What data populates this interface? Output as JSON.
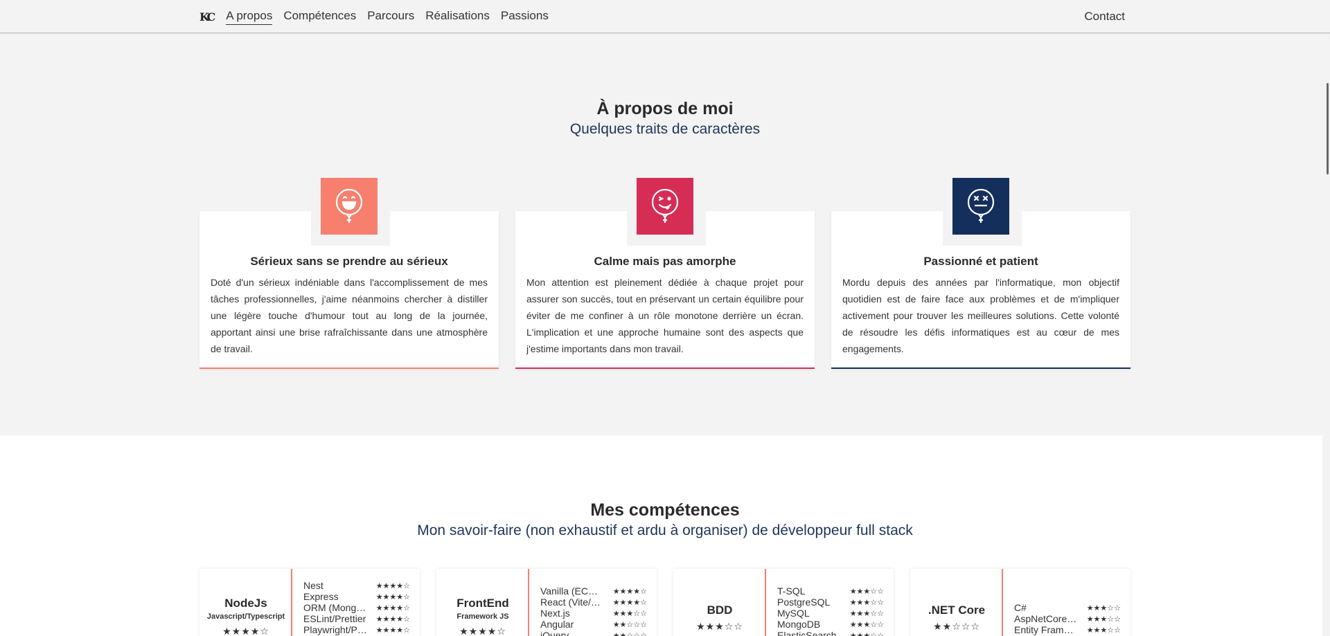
{
  "nav": {
    "logo": "KC",
    "links": [
      "A propos",
      "Compétences",
      "Parcours",
      "Réalisations",
      "Passions"
    ],
    "contact": "Contact"
  },
  "about": {
    "title": "À propos de moi",
    "subtitle": "Quelques traits de caractères",
    "traits": [
      {
        "title": "Sérieux sans se prendre au sérieux",
        "text": "Doté d'un sérieux indéniable dans l'accomplissement de mes tâches professionnelles, j'aime néanmoins chercher à distiller une légère touche d'humour tout au long de la journée, apportant ainsi une brise rafraîchissante dans une atmosphère de travail.",
        "color": "#f77f6e",
        "icon": "laughing-balloon-icon"
      },
      {
        "title": "Calme mais pas amorphe",
        "text": "Mon attention est pleinement dédiée à chaque projet pour assurer son succès, tout en préservant un certain équilibre pour éviter de me confiner à un rôle monotone derrière un écran. L'implication et une approche humaine sont des aspects que j'estime importants dans mon travail.",
        "color": "#d62d55",
        "icon": "winking-balloon-icon"
      },
      {
        "title": "Passionné et patient",
        "text": "Mordu depuis des années par l'informatique, mon objectif quotidien est de faire face aux problèmes et de m'impliquer activement pour trouver les meilleures solutions. Cette volonté de résoudre les défis informatiques est au cœur de mes engagements.",
        "color": "#142f5c",
        "icon": "dizzy-balloon-icon"
      }
    ]
  },
  "skills": {
    "title": "Mes compétences",
    "subtitle": "Mon savoir-faire (non exhaustif et ardu à organiser) de développeur full stack",
    "cards": [
      {
        "name": "NodeJs",
        "sub": "Javascript/Typescript",
        "stars": "★★★★☆",
        "items": [
          {
            "name": "Nest",
            "stars": "★★★★☆"
          },
          {
            "name": "Express",
            "stars": "★★★★☆"
          },
          {
            "name": "ORM (Mongoose)",
            "stars": "★★★★☆"
          },
          {
            "name": "ESLint/Prettier",
            "stars": "★★★★☆"
          },
          {
            "name": "Playwright/Puppeteer",
            "stars": "★★★★☆"
          }
        ]
      },
      {
        "name": "FrontEnd",
        "sub": "Framework JS",
        "stars": "★★★★☆",
        "items": [
          {
            "name": "Vanilla (ECMAScript)",
            "stars": "★★★★☆"
          },
          {
            "name": "React (Vite/Redux)",
            "stars": "★★★★☆"
          },
          {
            "name": "Next.js",
            "stars": "★★★☆☆"
          },
          {
            "name": "Angular",
            "stars": "★★☆☆☆"
          },
          {
            "name": "jQuery",
            "stars": "★★☆☆☆"
          }
        ]
      },
      {
        "name": "BDD",
        "sub": "",
        "stars": "★★★☆☆",
        "items": [
          {
            "name": "T-SQL",
            "stars": "★★★☆☆"
          },
          {
            "name": "PostgreSQL",
            "stars": "★★★☆☆"
          },
          {
            "name": "MySQL",
            "stars": "★★★☆☆"
          },
          {
            "name": "MongoDB",
            "stars": "★★★☆☆"
          },
          {
            "name": "ElasticSearch",
            "stars": "★★★☆☆"
          }
        ]
      },
      {
        "name": ".NET Core",
        "sub": "",
        "stars": "★★☆☆☆",
        "items": [
          {
            "name": "C#",
            "stars": "★★★☆☆"
          },
          {
            "name": "AspNetCore.Mvc",
            "stars": "★★★☆☆"
          },
          {
            "name": "Entity Framework",
            "stars": "★★★☆☆"
          }
        ]
      }
    ]
  }
}
